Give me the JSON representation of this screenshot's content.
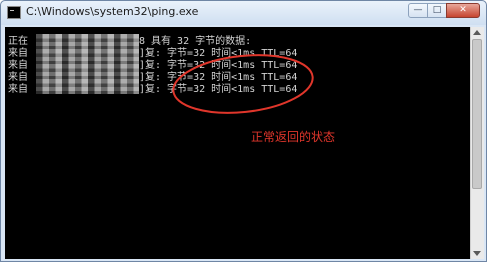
{
  "window": {
    "title": "C:\\Windows\\system32\\ping.exe",
    "controls": {
      "minimize": "—",
      "maximize": "□",
      "close": "✕"
    }
  },
  "console": {
    "header_prefix": "正在",
    "header_suffix": "8 具有 32 字节的数据:",
    "reply_prefix": "来自",
    "reply_lines": [
      "]复: 字节=32 时间<1ms TTL=64",
      "]复: 字节=32 时间<1ms TTL=64",
      "]复: 字节=32 时间<1ms TTL=64",
      "]复: 字节=32 时间<1ms TTL=64"
    ]
  },
  "annotation": {
    "text": "正常返回的状态",
    "color": "#e0362b"
  },
  "colors": {
    "console_bg": "#000000",
    "console_text": "#d4d4d4",
    "titlebar": "#cfdff1"
  }
}
